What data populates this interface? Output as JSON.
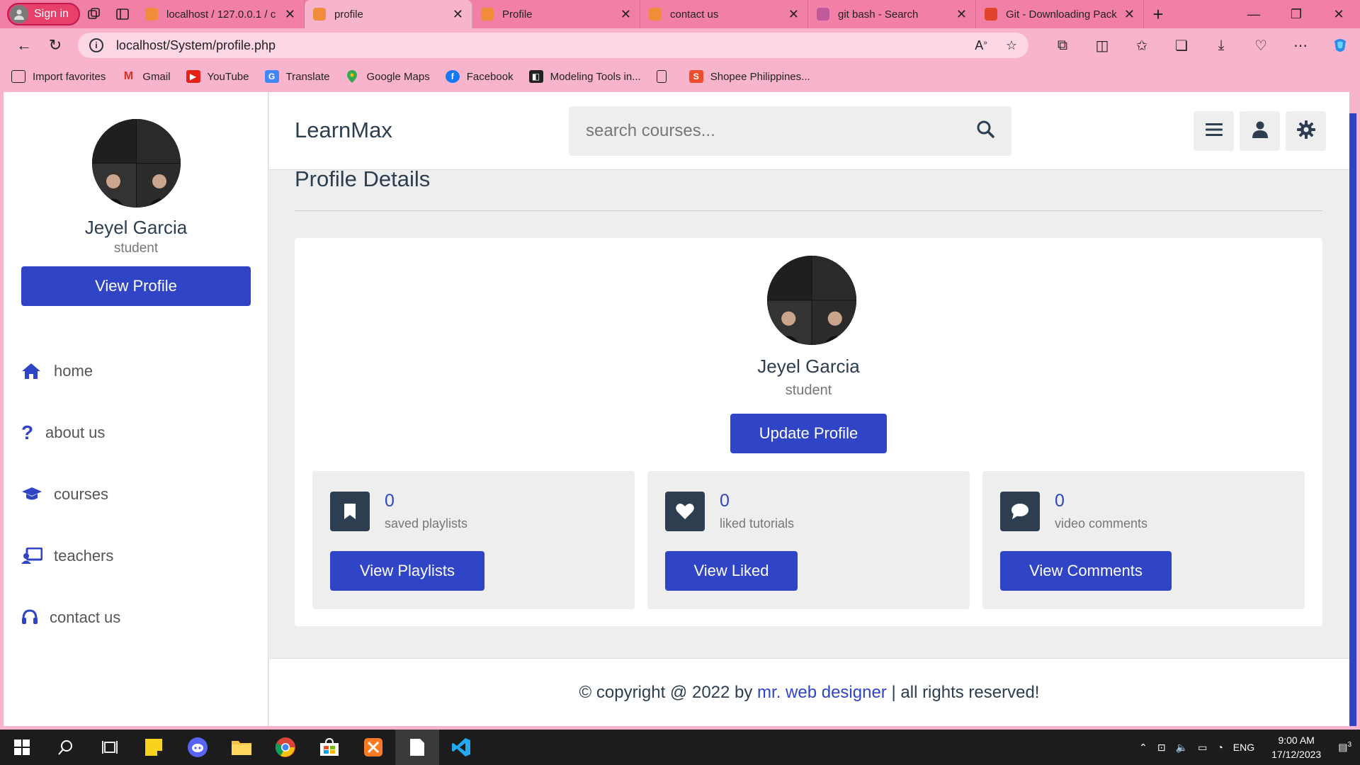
{
  "browser": {
    "signin": "Sign in",
    "tabs": [
      {
        "title": "localhost / 127.0.0.1 / c",
        "color": "#f08c3a"
      },
      {
        "title": "profile",
        "color": "#f08c3a"
      },
      {
        "title": "Profile",
        "color": "#f08c3a"
      },
      {
        "title": "contact us",
        "color": "#f08c3a"
      },
      {
        "title": "git bash - Search",
        "color": "#c05a9a"
      },
      {
        "title": "Git - Downloading Pack",
        "color": "#e0452b"
      }
    ],
    "url": "localhost/System/profile.php",
    "favorites": [
      {
        "label": "Import favorites",
        "icon": "import-icon"
      },
      {
        "label": "Gmail",
        "icon": "gmail-icon"
      },
      {
        "label": "YouTube",
        "icon": "youtube-icon"
      },
      {
        "label": "Translate",
        "icon": "translate-icon"
      },
      {
        "label": "Google Maps",
        "icon": "maps-icon"
      },
      {
        "label": "Facebook",
        "icon": "facebook-icon"
      },
      {
        "label": "Modeling Tools in...",
        "icon": "modeling-icon"
      },
      {
        "label": "",
        "icon": "page-icon"
      },
      {
        "label": "Shopee Philippines...",
        "icon": "shopee-icon"
      }
    ]
  },
  "sidebar": {
    "name": "Jeyel Garcia",
    "role": "student",
    "view_profile": "View Profile",
    "nav": [
      {
        "label": "home",
        "icon": "home-icon"
      },
      {
        "label": "about us",
        "icon": "question-icon"
      },
      {
        "label": "courses",
        "icon": "graduation-cap-icon"
      },
      {
        "label": "teachers",
        "icon": "teacher-icon"
      },
      {
        "label": "contact us",
        "icon": "headset-icon"
      }
    ]
  },
  "header": {
    "logo": "LearnMax",
    "search_placeholder": "search courses..."
  },
  "main": {
    "title": "Profile Details",
    "name": "Jeyel Garcia",
    "role": "student",
    "update_btn": "Update Profile",
    "stats": [
      {
        "value": "0",
        "label": "saved playlists",
        "button": "View Playlists",
        "icon": "bookmark-icon"
      },
      {
        "value": "0",
        "label": "liked tutorials",
        "button": "View Liked",
        "icon": "heart-icon"
      },
      {
        "value": "0",
        "label": "video comments",
        "button": "View Comments",
        "icon": "comment-icon"
      }
    ]
  },
  "footer": {
    "prefix": "© copyright @ 2022 by ",
    "link": "mr. web designer",
    "suffix": " | all rights reserved!"
  },
  "taskbar": {
    "lang": "ENG",
    "time": "9:00 AM",
    "date": "17/12/2023",
    "notif_count": "3"
  },
  "colors": {
    "accent": "#2f45c5",
    "dark": "#2c3e50",
    "chrome": "#f9b4cd"
  }
}
